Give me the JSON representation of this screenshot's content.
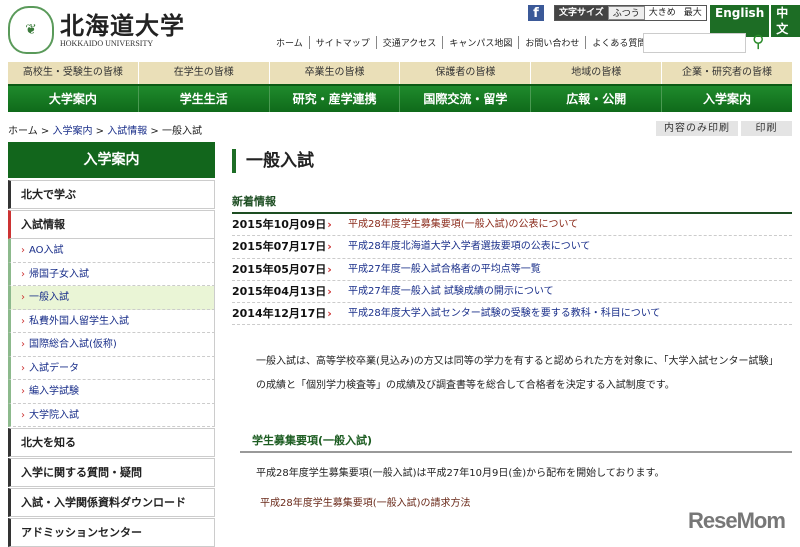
{
  "header": {
    "logo_jp": "北海道大学",
    "logo_en": "HOKKAIDO UNIVERSITY",
    "emblem_icon": "hokkaido-emblem",
    "font_size": {
      "label": "文字サイズ",
      "options": [
        "ふつう",
        "大きめ",
        "最大"
      ]
    },
    "languages": [
      "English",
      "中文"
    ],
    "util_links": [
      "ホーム",
      "サイトマップ",
      "交通アクセス",
      "キャンパス地図",
      "お問い合わせ",
      "よくある質問"
    ],
    "search_placeholder": ""
  },
  "audience_nav": [
    "高校生・受験生の皆様",
    "在学生の皆様",
    "卒業生の皆様",
    "保護者の皆様",
    "地域の皆様",
    "企業・研究者の皆様"
  ],
  "main_nav": [
    "大学案内",
    "学生生活",
    "研究・産学連携",
    "国際交流・留学",
    "広報・公開",
    "入学案内"
  ],
  "breadcrumb": [
    "ホーム",
    "入学案内",
    "入試情報",
    "一般入試"
  ],
  "print_buttons": [
    "内容のみ印刷",
    "印刷"
  ],
  "sidebar": {
    "heading": "入学案内",
    "top": [
      "北大で学ぶ",
      "入試情報"
    ],
    "sub": [
      "AO入試",
      "帰国子女入試",
      "一般入試",
      "私費外国人留学生入試",
      "国際総合入試(仮称)",
      "入試データ",
      "編入学試験",
      "大学院入試"
    ],
    "bottom": [
      "北大を知る",
      "入学に関する質問・疑問",
      "入試・入学関係資料ダウンロード",
      "アドミッションセンター"
    ]
  },
  "main": {
    "title": "一般入試",
    "news_heading": "新着情報",
    "news": [
      {
        "date": "2015年10月09日",
        "title": "平成28年度学生募集要項(一般入試)の公表について"
      },
      {
        "date": "2015年07月17日",
        "title": "平成28年度北海道大学入学者選抜要項の公表について"
      },
      {
        "date": "2015年05月07日",
        "title": "平成27年度一般入試合格者の平均点等一覧"
      },
      {
        "date": "2015年04月13日",
        "title": "平成27年度一般入試 試験成績の開示について"
      },
      {
        "date": "2014年12月17日",
        "title": "平成28年度大学入試センター試験の受験を要する教科・科目について"
      }
    ],
    "paragraph": "一般入試は、高等学校卒業(見込み)の方又は同等の学力を有すると認められた方を対象に、「大学入試センター試験」の成績と「個別学力検査等」の成績及び調査書等を総合して合格者を決定する入試制度です。",
    "section_heading": "学生募集要項(一般入試)",
    "section_text": "平成28年度学生募集要項(一般入試)は平成27年10月9日(金)から配布を開始しております。",
    "section_link": "平成28年度学生募集要項(一般入試)の請求方法"
  },
  "watermark": "ReseMom"
}
